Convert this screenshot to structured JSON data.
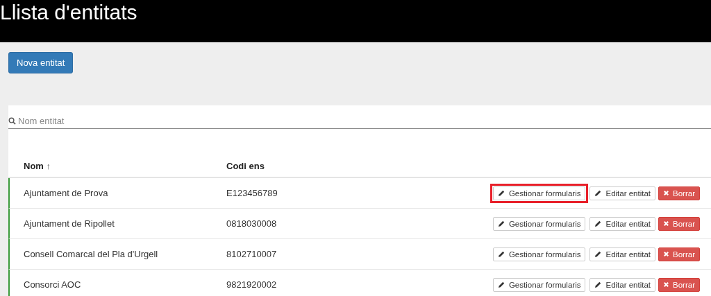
{
  "header": {
    "title": "Llista d'entitats"
  },
  "new_button": {
    "label": "Nova entitat"
  },
  "search": {
    "placeholder": "Nom entitat"
  },
  "table": {
    "columns": [
      {
        "label": "Nom",
        "sort": "↑"
      },
      {
        "label": "Codi ens"
      }
    ],
    "rows": [
      {
        "name": "Ajuntament de Prova",
        "code": "E123456789",
        "highlighted": true,
        "actions": {
          "manage": "Gestionar formularis",
          "edit": "Editar entitat",
          "delete": "Borrar"
        }
      },
      {
        "name": "Ajuntament de Ripollet",
        "code": "0818030008",
        "highlighted": false,
        "actions": {
          "manage": "Gestionar formularis",
          "edit": "Editar entitat",
          "delete": "Borrar"
        }
      },
      {
        "name": "Consell Comarcal del Pla d'Urgell",
        "code": "8102710007",
        "highlighted": false,
        "actions": {
          "manage": "Gestionar formularis",
          "edit": "Editar entitat",
          "delete": "Borrar"
        }
      },
      {
        "name": "Consorci AOC",
        "code": "9821920002",
        "highlighted": false,
        "actions": {
          "manage": "Gestionar formularis",
          "edit": "Editar entitat",
          "delete": "Borrar"
        }
      }
    ]
  }
}
